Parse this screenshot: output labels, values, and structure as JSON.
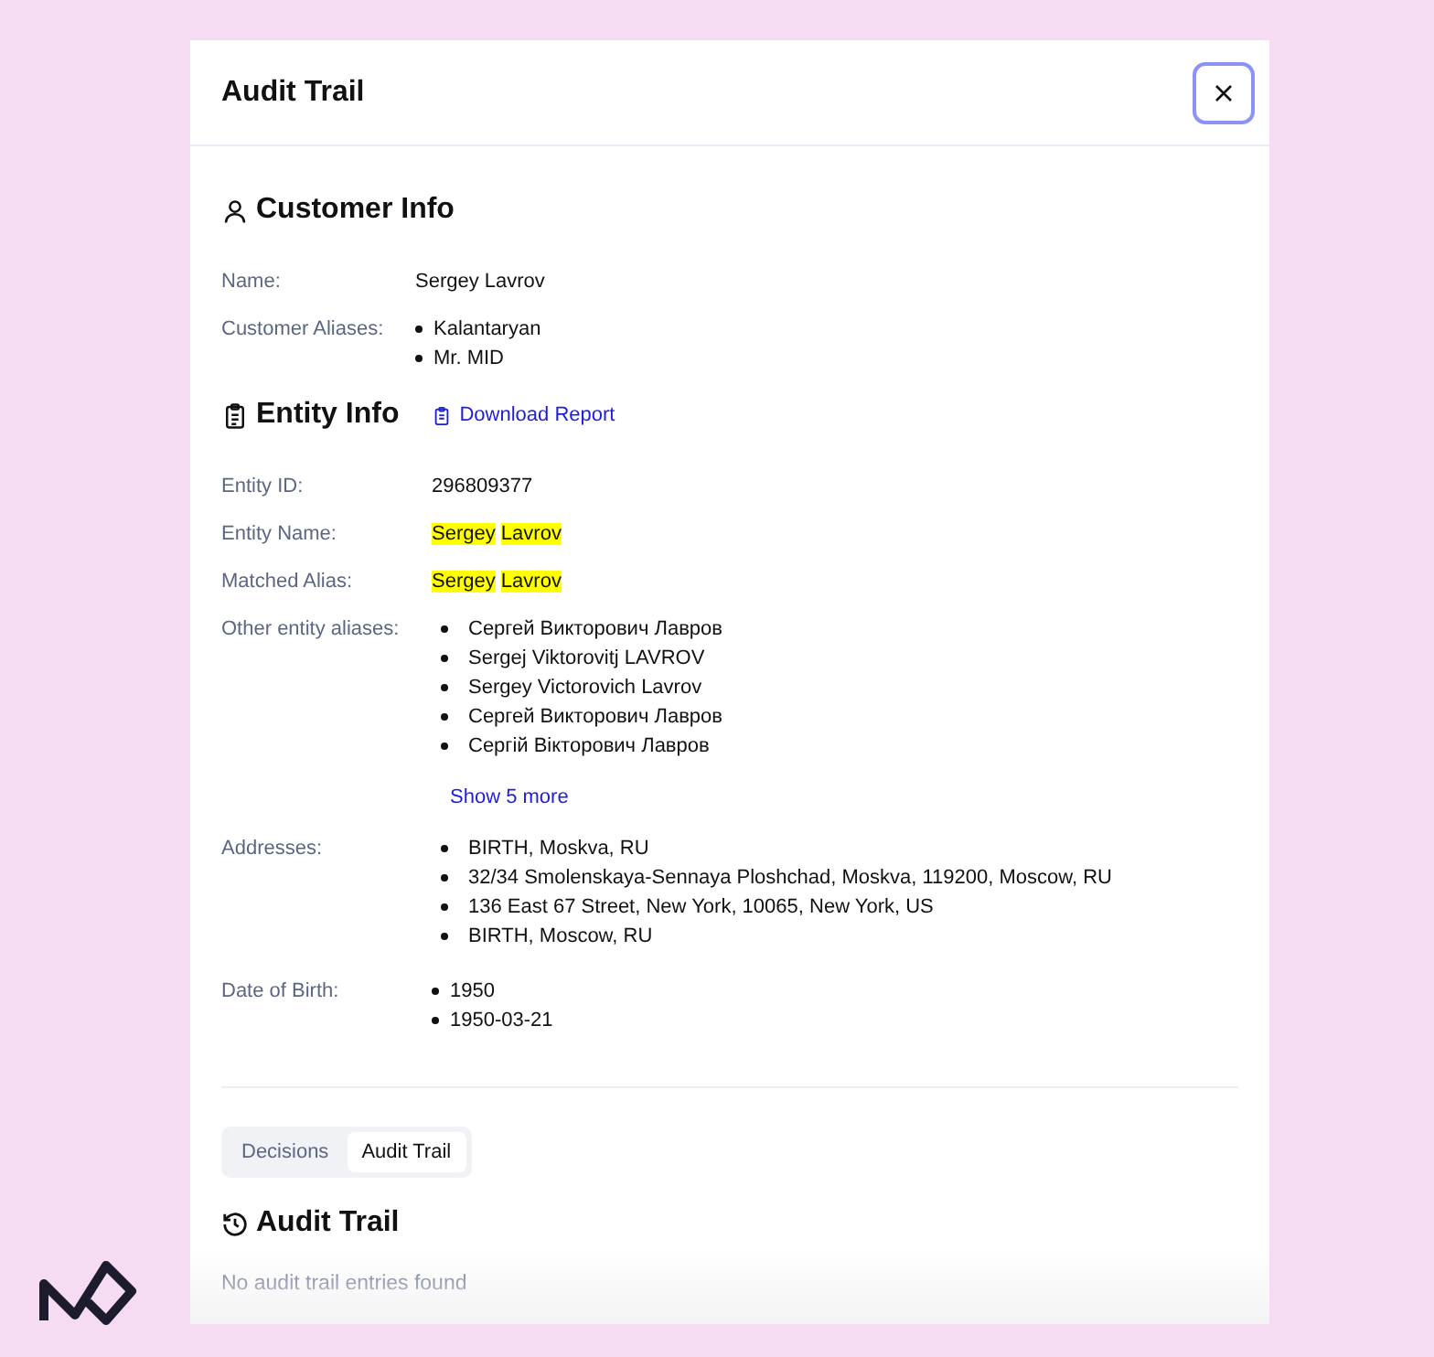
{
  "dialog": {
    "title": "Audit Trail"
  },
  "customer_info": {
    "title": "Customer Info",
    "fields": [
      {
        "label": "Name:",
        "kind": "text",
        "value": "Sergey Lavrov"
      },
      {
        "label": "Customer Aliases:",
        "kind": "list",
        "indent": false,
        "items": [
          "Kalantaryan",
          "Mr. MID"
        ]
      }
    ]
  },
  "entity_info": {
    "title": "Entity Info",
    "link": "Download Report",
    "fields": [
      {
        "label": "Entity ID:",
        "kind": "text",
        "value": "296809377"
      },
      {
        "label": "Entity Name:",
        "kind": "highlight",
        "value": "Sergey Lavrov"
      },
      {
        "label": "Matched Alias:",
        "kind": "highlight",
        "value": "Sergey Lavrov"
      },
      {
        "label": "Other entity aliases:",
        "kind": "list",
        "indent": true,
        "items": [
          "Сергей Викторович Лавров",
          "Sergej Viktorovitj LAVROV",
          "Sergey Victorovich Lavrov",
          "Сергей Викторович Лавров",
          "Сергій Вікторович Лавров"
        ],
        "more": "Show 5 more"
      },
      {
        "label": "Addresses:",
        "kind": "list",
        "indent": true,
        "items": [
          "BIRTH, Moskva, RU",
          "32/34 Smolenskaya-Sennaya Ploshchad, Moskva, 119200, Moscow, RU",
          "136 East 67 Street, New York, 10065, New York, US",
          "BIRTH, Moscow, RU"
        ]
      },
      {
        "label": "Date of Birth:",
        "kind": "list",
        "indent": false,
        "items": [
          "1950",
          "1950-03-21"
        ]
      }
    ]
  },
  "tabs": [
    {
      "label": "Decisions",
      "selected": false
    },
    {
      "label": "Audit Trail",
      "selected": true
    }
  ],
  "audit_trail": {
    "title": "Audit Trail",
    "empty_message": "No audit trail entries found"
  }
}
